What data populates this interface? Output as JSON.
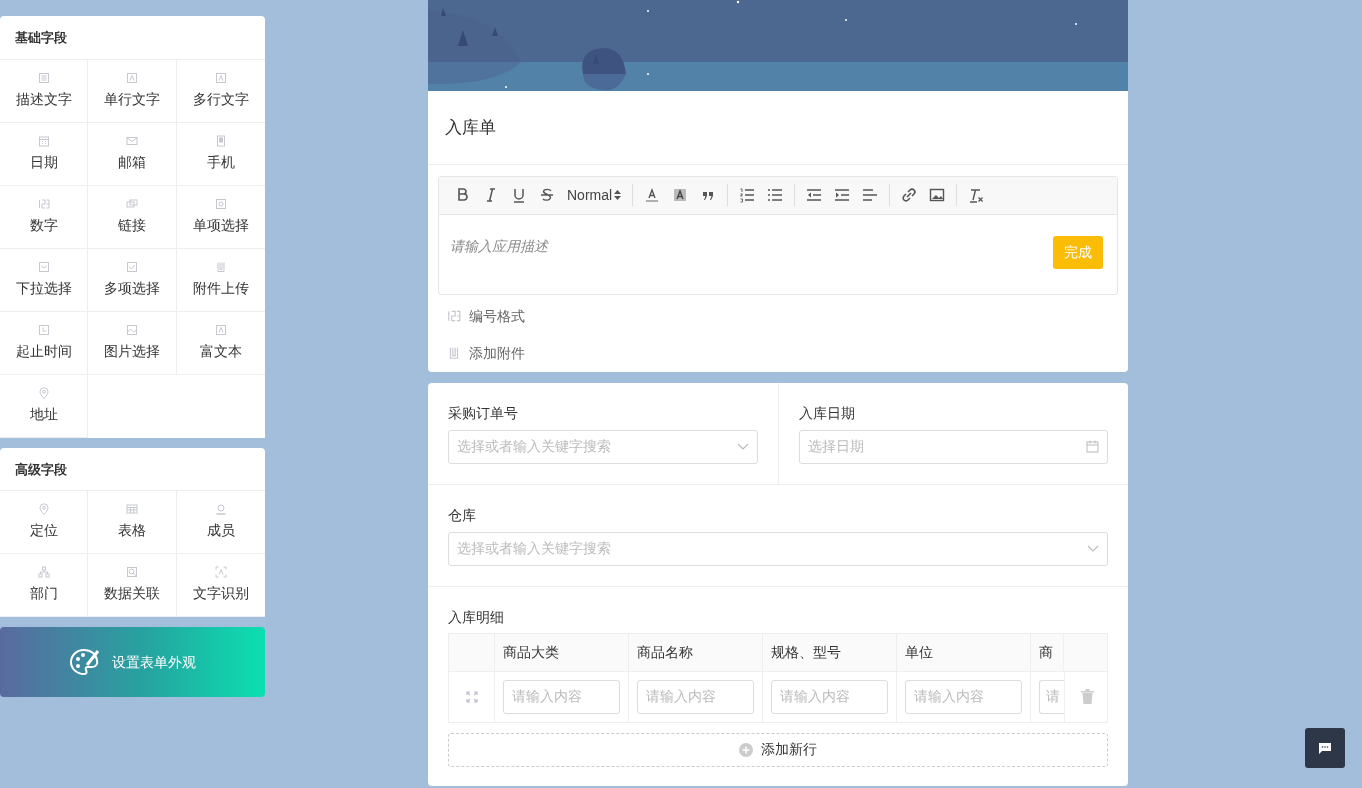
{
  "basic_fields": {
    "title": "基础字段",
    "items": [
      {
        "label": "描述文字"
      },
      {
        "label": "单行文字"
      },
      {
        "label": "多行文字"
      },
      {
        "label": "日期"
      },
      {
        "label": "邮箱"
      },
      {
        "label": "手机"
      },
      {
        "label": "数字"
      },
      {
        "label": "链接"
      },
      {
        "label": "单项选择"
      },
      {
        "label": "下拉选择"
      },
      {
        "label": "多项选择"
      },
      {
        "label": "附件上传"
      },
      {
        "label": "起止时间"
      },
      {
        "label": "图片选择"
      },
      {
        "label": "富文本"
      },
      {
        "label": "地址"
      }
    ]
  },
  "advanced_fields": {
    "title": "高级字段",
    "items": [
      {
        "label": "定位"
      },
      {
        "label": "表格"
      },
      {
        "label": "成员"
      },
      {
        "label": "部门"
      },
      {
        "label": "数据关联"
      },
      {
        "label": "文字识别"
      }
    ]
  },
  "appearance_button": {
    "label": "设置表单外观"
  },
  "form_header": {
    "title": "入库单",
    "toolbar": {
      "format": "Normal"
    },
    "description": {
      "placeholder": "请输入应用描述"
    },
    "done_button": "完成",
    "options": [
      {
        "label": "编号格式"
      },
      {
        "label": "添加附件"
      }
    ]
  },
  "form_fields": [
    {
      "label": "采购订单号",
      "placeholder": "选择或者输入关键字搜索",
      "kind": "select"
    },
    {
      "label": "入库日期",
      "placeholder": "选择日期",
      "kind": "date"
    },
    {
      "label": "仓库",
      "placeholder": "选择或者输入关键字搜索",
      "kind": "select"
    }
  ],
  "detail_table": {
    "title": "入库明细",
    "columns": [
      "商品大类",
      "商品名称",
      "规格、型号",
      "单位",
      "商"
    ],
    "rows": [
      {
        "cells": [
          {
            "placeholder": "请输入内容"
          },
          {
            "placeholder": "请输入内容"
          },
          {
            "placeholder": "请输入内容"
          },
          {
            "placeholder": "请输入内容"
          },
          {
            "placeholder": "请"
          }
        ]
      }
    ],
    "add_row": "添加新行"
  }
}
